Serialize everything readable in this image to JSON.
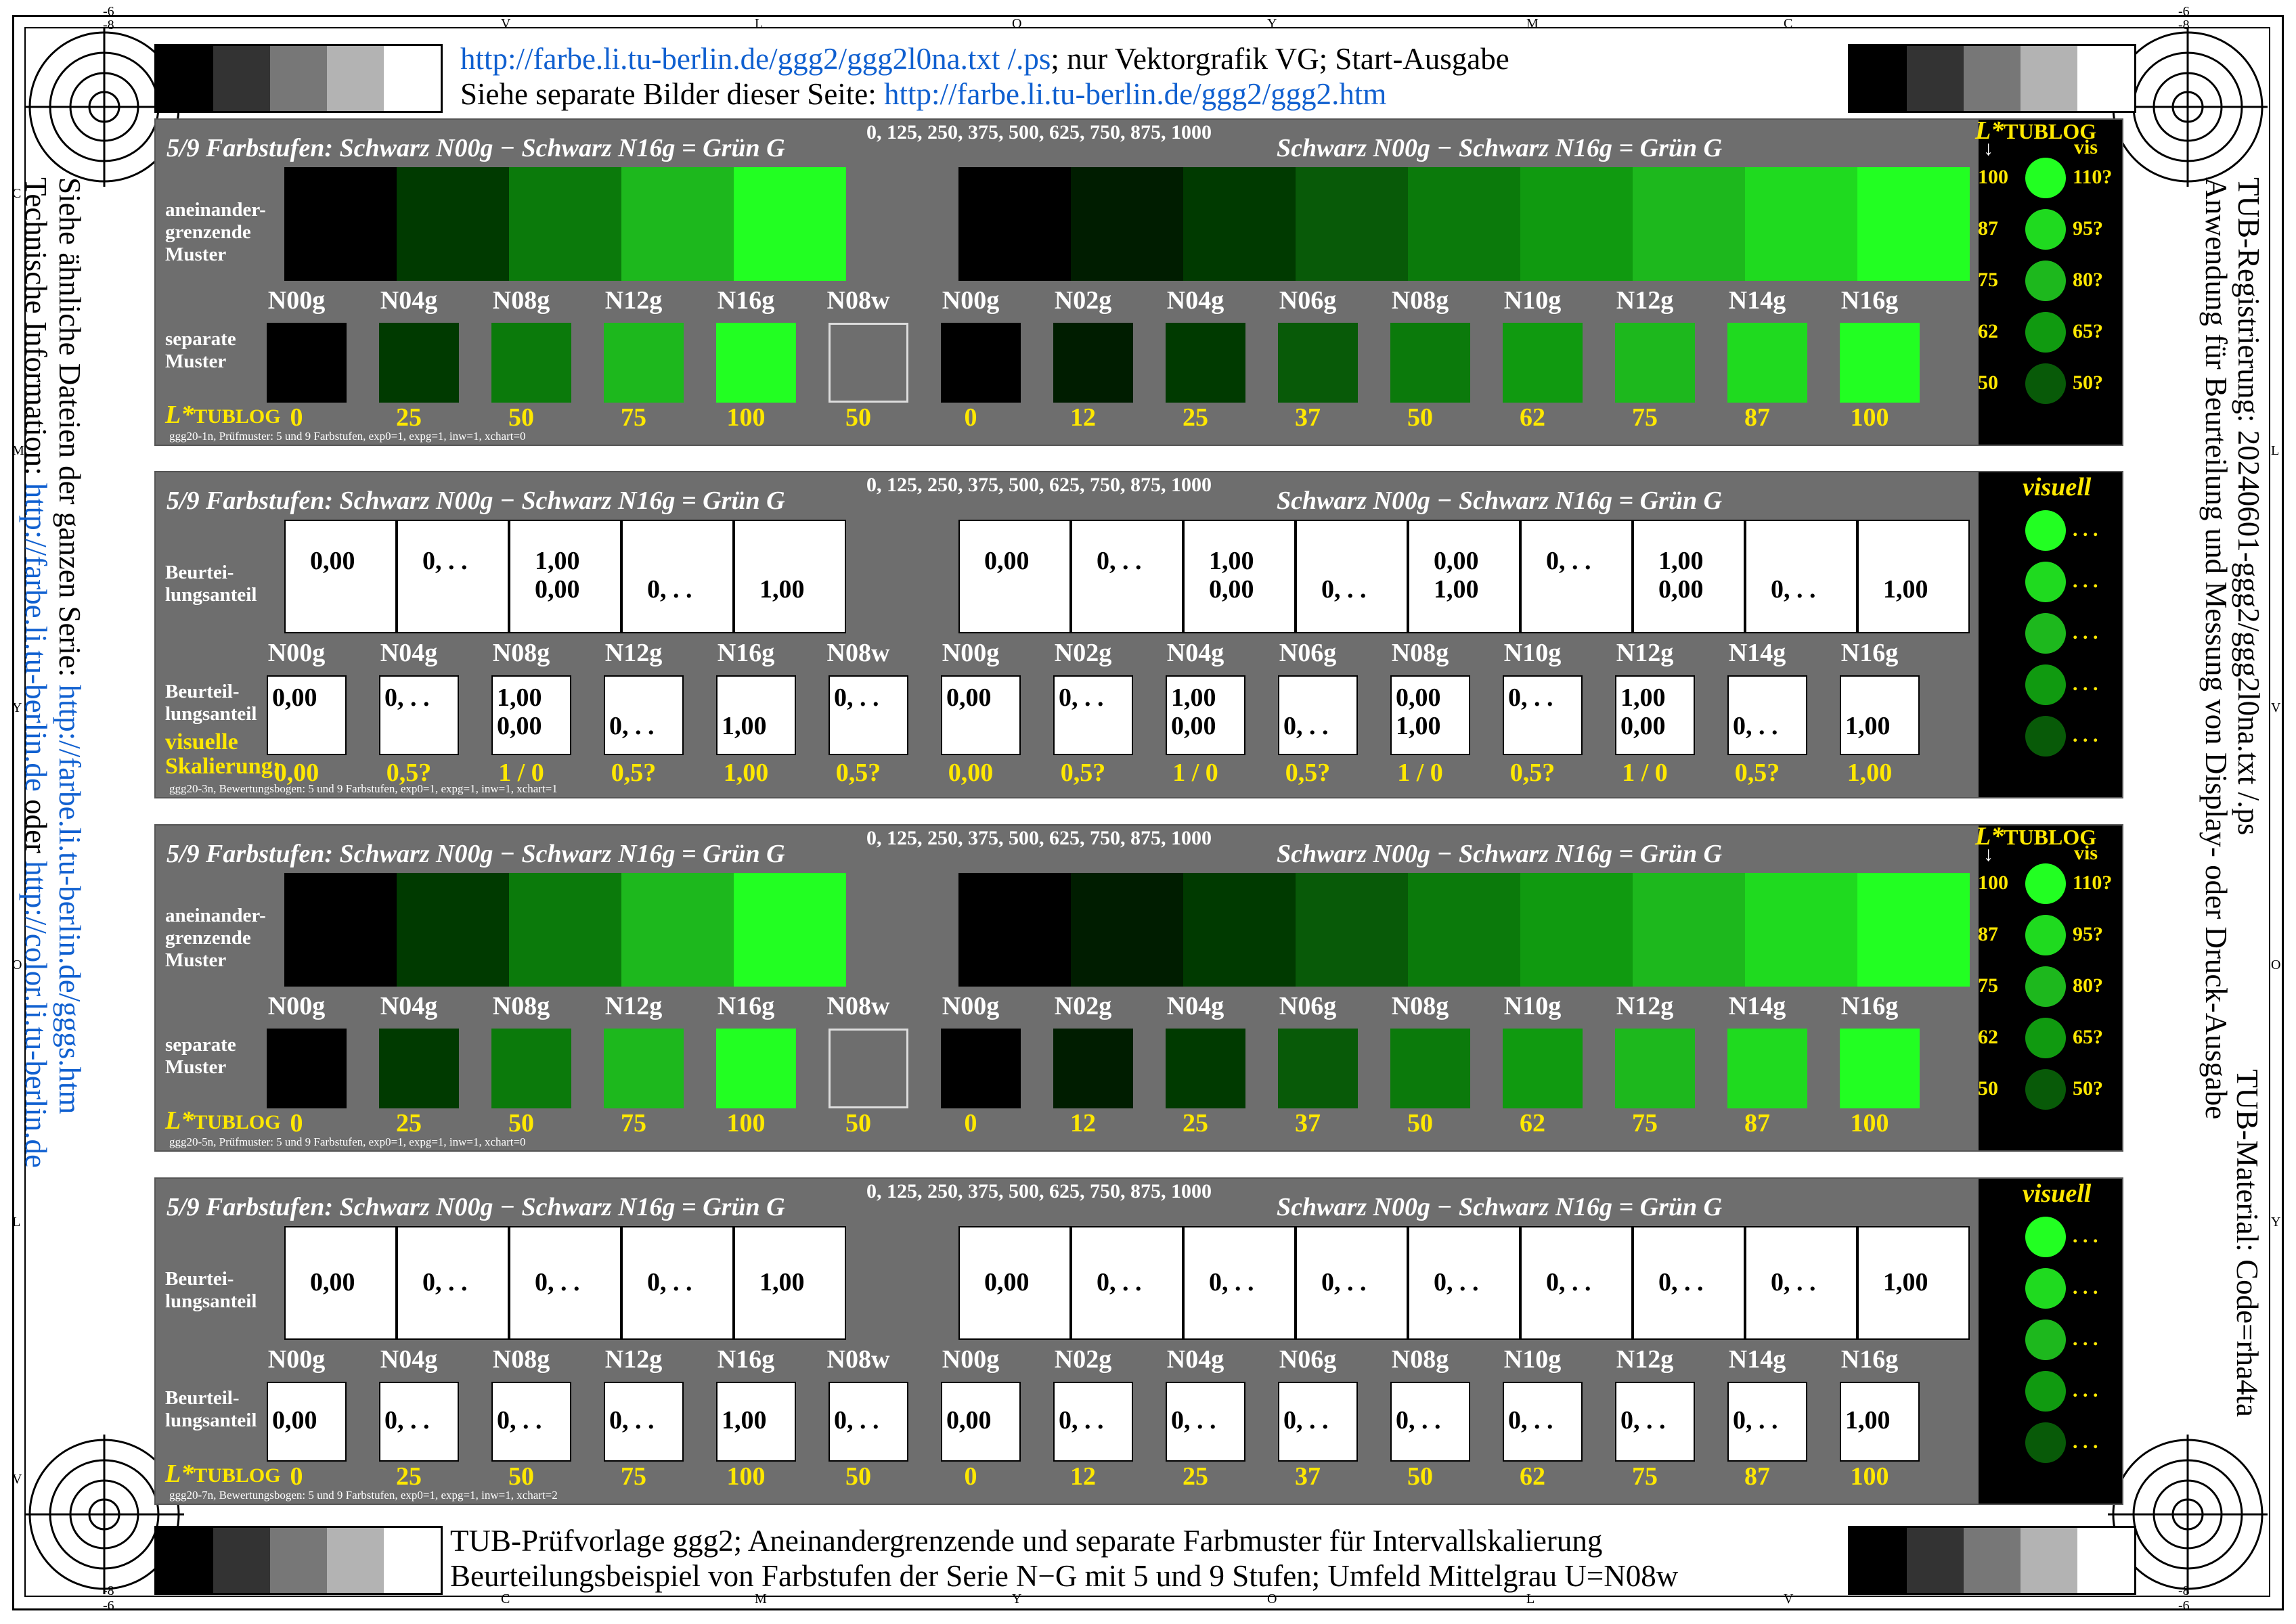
{
  "header": {
    "line1_link": "http://farbe.li.tu-berlin.de/ggg2/ggg2l0na.txt /.ps",
    "line1_rest": "; nur Vektorgrafik VG; Start-Ausgabe",
    "line2_text": "Siehe separate Bilder dieser Seite: ",
    "line2_link": "http://farbe.li.tu-berlin.de/ggg2/ggg2.htm"
  },
  "footer_caption": {
    "line1": "TUB-Prüfvorlage ggg2; Aneinandergrenzende und separate Farbmuster für Intervallskalierung",
    "line2": "Beurteilungsbeispiel von Farbstufen der Serie N−G mit 5 und 9 Stufen; Umfeld Mittelgrau U=N08w"
  },
  "left_side": {
    "line1_text": "Siehe ähnliche Dateien der ganzen Serie: ",
    "line1_link": "http://farbe.li.tu-berlin.de/gggs.htm",
    "line2_text": "Technische Information: ",
    "line2_link": "http://farbe.li.tu-berlin.de",
    "line2_mid": " oder ",
    "line2_link2": "http://color.li.tu-berlin.de"
  },
  "right_side": {
    "line1": "TUB-Registrierung: 20240601-ggg2/ggg2l0na.txt /.ps",
    "line2": "Anwendung für Beurteilung und Messung von Display- oder Druck-Ausgabe",
    "line3": "TUB-Material: Code=rha4ta"
  },
  "edge_letters": {
    "top": [
      "V",
      "L",
      "O",
      "Y",
      "M",
      "C"
    ],
    "bottom": [
      "C",
      "M",
      "Y",
      "O",
      "L",
      "V"
    ],
    "left": [
      "C",
      "M",
      "Y",
      "O",
      "L",
      "V"
    ],
    "right": [
      "L",
      "V",
      "O",
      "Y",
      "M",
      "C"
    ],
    "corner_tl": [
      "-6",
      "-8"
    ],
    "corner_tr": [
      "-6",
      "-8"
    ],
    "corner_bl": [
      "-8",
      "-6"
    ],
    "corner_br": [
      "-8",
      "-6"
    ]
  },
  "common": {
    "title_left": "5/9 Farbstufen:  Schwarz N00g − Schwarz N16g = Grün G",
    "title_right": "Schwarz N00g − Schwarz N16g = Grün G",
    "numbers": "0, 125, 250, 375, 500, 625, 750, 875, 1000",
    "codes5": [
      "N00g",
      "N04g",
      "N08g",
      "N12g",
      "N16g",
      "N08w"
    ],
    "codes9": [
      "N00g",
      "N02g",
      "N04g",
      "N06g",
      "N08g",
      "N10g",
      "N12g",
      "N14g",
      "N16g"
    ],
    "lvals5": [
      "0",
      "25",
      "50",
      "75",
      "100",
      "50"
    ],
    "lvals9": [
      "0",
      "12",
      "25",
      "37",
      "50",
      "62",
      "75",
      "87",
      "100"
    ],
    "lstar": "L*",
    "lstar_sub": "TUBLOG",
    "label_adjacent": [
      "aneinander-",
      "grenzende",
      "Muster"
    ],
    "label_separate": [
      "separate",
      "Muster"
    ],
    "label_beurteil": [
      "Beurtei-",
      "lungsanteil"
    ],
    "label_beurteil2": [
      "Beurteil-",
      "lungsanteil"
    ],
    "visuell": "visuell",
    "visuelle": "visuelle",
    "skalierung": "Skalierung:",
    "dots_text": ". . .",
    "vis": "vis",
    "tublog_title": "TUBLOG",
    "arrow": "↓"
  },
  "colors": {
    "panel_bg": "#6e6e6e",
    "gray_strip": [
      "#000000",
      "#333333",
      "#777777",
      "#b3b3b3",
      "#ffffff"
    ],
    "green5": [
      "#000000",
      "#003a00",
      "#0b7a0b",
      "#1db81d",
      "#22ff22",
      "#6e6e6e"
    ],
    "green9": [
      "#000000",
      "#001d00",
      "#003a00",
      "#085a08",
      "#0b7a0b",
      "#109a10",
      "#1db81d",
      "#1fda1f",
      "#22ff22"
    ],
    "dots": [
      "#22ff22",
      "#1fda1f",
      "#1db81d",
      "#109a10",
      "#085a08"
    ],
    "accent_yellow": "#ffe800",
    "link_blue": "#1060d0"
  },
  "scale_legend": {
    "left": [
      "100",
      "87",
      "75",
      "62",
      "50"
    ],
    "right": [
      "110?",
      "95?",
      "80?",
      "65?",
      "50?"
    ]
  },
  "panels": [
    {
      "footer": "ggg20-1n, Prüfmuster: 5 und 9 Farbstufen, exp0=1, expg=1, inw=1, xchart=0"
    },
    {
      "footer": "ggg20-3n, Bewertungsbogen: 5 und 9 Farbstufen, exp0=1, expg=1, inw=1, xchart=1",
      "top_cells": [
        [
          "0,00",
          ""
        ],
        [
          "0, . .",
          ""
        ],
        [
          "1,00",
          "0,00"
        ],
        [
          "",
          "0, . ."
        ],
        [
          "",
          "1,00"
        ],
        [
          "0,00",
          ""
        ],
        [
          "0, . .",
          ""
        ],
        [
          "1,00",
          "0,00"
        ],
        [
          "",
          "0, . ."
        ],
        [
          "0,00",
          "1,00"
        ],
        [
          "0, . .",
          ""
        ],
        [
          "1,00",
          "0,00"
        ],
        [
          "",
          "0, . ."
        ],
        [
          "",
          "1,00"
        ]
      ],
      "sq_cells": [
        [
          "0,00",
          ""
        ],
        [
          "0, . .",
          ""
        ],
        [
          "1,00",
          "0,00"
        ],
        [
          "",
          "0, . ."
        ],
        [
          "",
          "1,00"
        ],
        [
          "0, . .",
          ""
        ],
        [
          "0,00",
          ""
        ],
        [
          "0, . .",
          ""
        ],
        [
          "1,00",
          "0,00"
        ],
        [
          "",
          "0, . ."
        ],
        [
          "0,00",
          "1,00"
        ],
        [
          "0, . .",
          ""
        ],
        [
          "1,00",
          "0,00"
        ],
        [
          "",
          "0, . ."
        ],
        [
          "",
          "1,00"
        ]
      ],
      "scale": [
        "0,00",
        "0,5?",
        "1 / 0",
        "0,5?",
        "1,00",
        "0,5?",
        "0,00",
        "0,5?",
        "1 / 0",
        "0,5?",
        "1 / 0",
        "0,5?",
        "1 / 0",
        "0,5?",
        "1,00"
      ]
    },
    {
      "footer": "ggg20-5n, Prüfmuster: 5 und 9 Farbstufen, exp0=1, expg=1, inw=1, xchart=0"
    },
    {
      "footer": "ggg20-7n, Bewertungsbogen: 5 und 9 Farbstufen, exp0=1, expg=1, inw=1, xchart=2",
      "top_cells": [
        "0,00",
        "0, . .",
        "0, . .",
        "0, . .",
        "1,00",
        "0,00",
        "0, . .",
        "0, . .",
        "0, . .",
        "0, . .",
        "0, . .",
        "0, . .",
        "0, . .",
        "1,00"
      ],
      "sq_cells": [
        "0,00",
        "0, . .",
        "0, . .",
        "0, . .",
        "1,00",
        "0, . .",
        "0,00",
        "0, . .",
        "0, . .",
        "0, . .",
        "0, . .",
        "0, . .",
        "0, . .",
        "0, . .",
        "1,00"
      ]
    }
  ]
}
